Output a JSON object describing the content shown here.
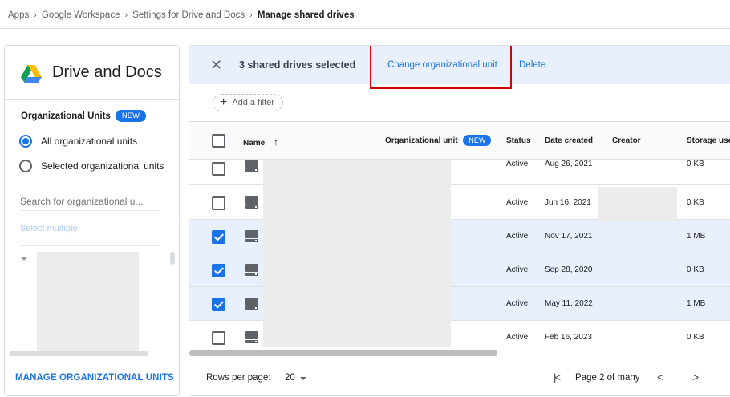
{
  "breadcrumb": {
    "items": [
      "Apps",
      "Google Workspace",
      "Settings for Drive and Docs",
      "Manage shared drives"
    ],
    "separator": "›"
  },
  "left_panel": {
    "title": "Drive and Docs",
    "ou_label": "Organizational Units",
    "new_badge": "NEW",
    "radio_all": "All organizational units",
    "radio_selected": "Selected organizational units",
    "search_placeholder": "Search for organizational u...",
    "select_multiple": "Select multiple",
    "manage_button": "MANAGE ORGANIZATIONAL UNITS"
  },
  "selection_bar": {
    "close": "✕",
    "selected_text": "3 shared drives selected",
    "change_ou": "Change organizational unit",
    "delete": "Delete"
  },
  "filter": {
    "plus": "+",
    "label": "Add a filter"
  },
  "table": {
    "headers": {
      "name": "Name",
      "sort_arrow": "↑",
      "org_unit": "Organizational unit",
      "org_unit_badge": "NEW",
      "status": "Status",
      "date_created": "Date created",
      "creator": "Creator",
      "storage": "Storage used"
    },
    "rows": [
      {
        "status": "Active",
        "date": "Aug 26, 2021",
        "storage": "0 KB",
        "selected": false
      },
      {
        "status": "Active",
        "date": "Jun 16, 2021",
        "storage": "0 KB",
        "selected": false
      },
      {
        "status": "Active",
        "date": "Nov 17, 2021",
        "storage": "1 MB",
        "selected": true
      },
      {
        "status": "Active",
        "date": "Sep 28, 2020",
        "storage": "0 KB",
        "selected": true
      },
      {
        "status": "Active",
        "date": "May 11, 2022",
        "storage": "1 MB",
        "selected": true
      },
      {
        "status": "Active",
        "date": "Feb 16, 2023",
        "storage": "0 KB",
        "selected": false
      }
    ]
  },
  "pagination": {
    "rows_label": "Rows per page:",
    "rows_value": "20",
    "first": "|<",
    "page_info": "Page 2 of many",
    "prev": "<",
    "next": ">"
  },
  "colors": {
    "accent": "#1a73e8",
    "selection_bg": "#e8f0fe",
    "highlight": "#d50000"
  }
}
